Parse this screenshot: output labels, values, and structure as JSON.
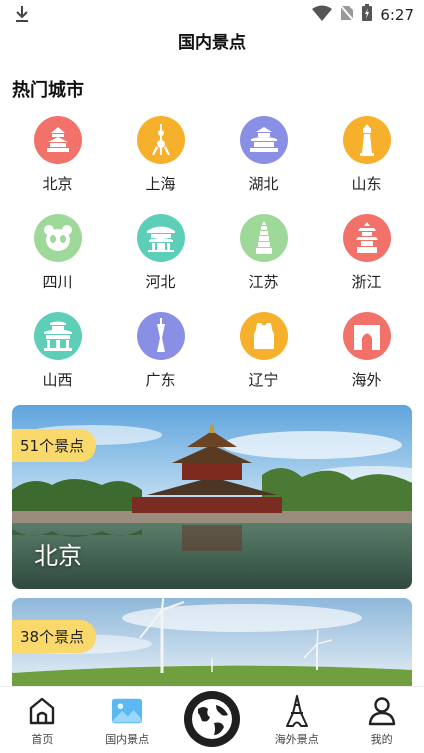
{
  "status": {
    "time": "6:27"
  },
  "header": {
    "title": "国内景点"
  },
  "hot_section": {
    "title": "热门城市"
  },
  "cities": [
    {
      "name": "北京",
      "color": "#f27168",
      "icon": "temple-of-heaven-icon"
    },
    {
      "name": "上海",
      "color": "#f6b02c",
      "icon": "oriental-pearl-tower-icon"
    },
    {
      "name": "湖北",
      "color": "#8a8fe6",
      "icon": "yellow-crane-tower-icon"
    },
    {
      "name": "山东",
      "color": "#f6b02c",
      "icon": "lighthouse-icon"
    },
    {
      "name": "四川",
      "color": "#9fd99a",
      "icon": "panda-icon"
    },
    {
      "name": "河北",
      "color": "#5dcfb8",
      "icon": "pavilion-icon"
    },
    {
      "name": "江苏",
      "color": "#9fd99a",
      "icon": "pagoda-icon"
    },
    {
      "name": "浙江",
      "color": "#f27168",
      "icon": "leifeng-pagoda-icon"
    },
    {
      "name": "山西",
      "color": "#5dcfb8",
      "icon": "ancient-building-icon"
    },
    {
      "name": "广东",
      "color": "#8a8fe6",
      "icon": "canton-tower-icon"
    },
    {
      "name": "辽宁",
      "color": "#f6b02c",
      "icon": "jersey-icon"
    },
    {
      "name": "海外",
      "color": "#f27168",
      "icon": "arch-gate-icon"
    }
  ],
  "cards": [
    {
      "badge": "51个景点",
      "city": "北京"
    },
    {
      "badge": "38个景点",
      "city": ""
    }
  ],
  "tabs": [
    {
      "label": "首页",
      "icon": "home-icon"
    },
    {
      "label": "国内景点",
      "icon": "landscape-picture-icon"
    },
    {
      "label": "",
      "icon": "globe-icon"
    },
    {
      "label": "海外景点",
      "icon": "eiffel-tower-icon"
    },
    {
      "label": "我的",
      "icon": "person-icon"
    }
  ]
}
